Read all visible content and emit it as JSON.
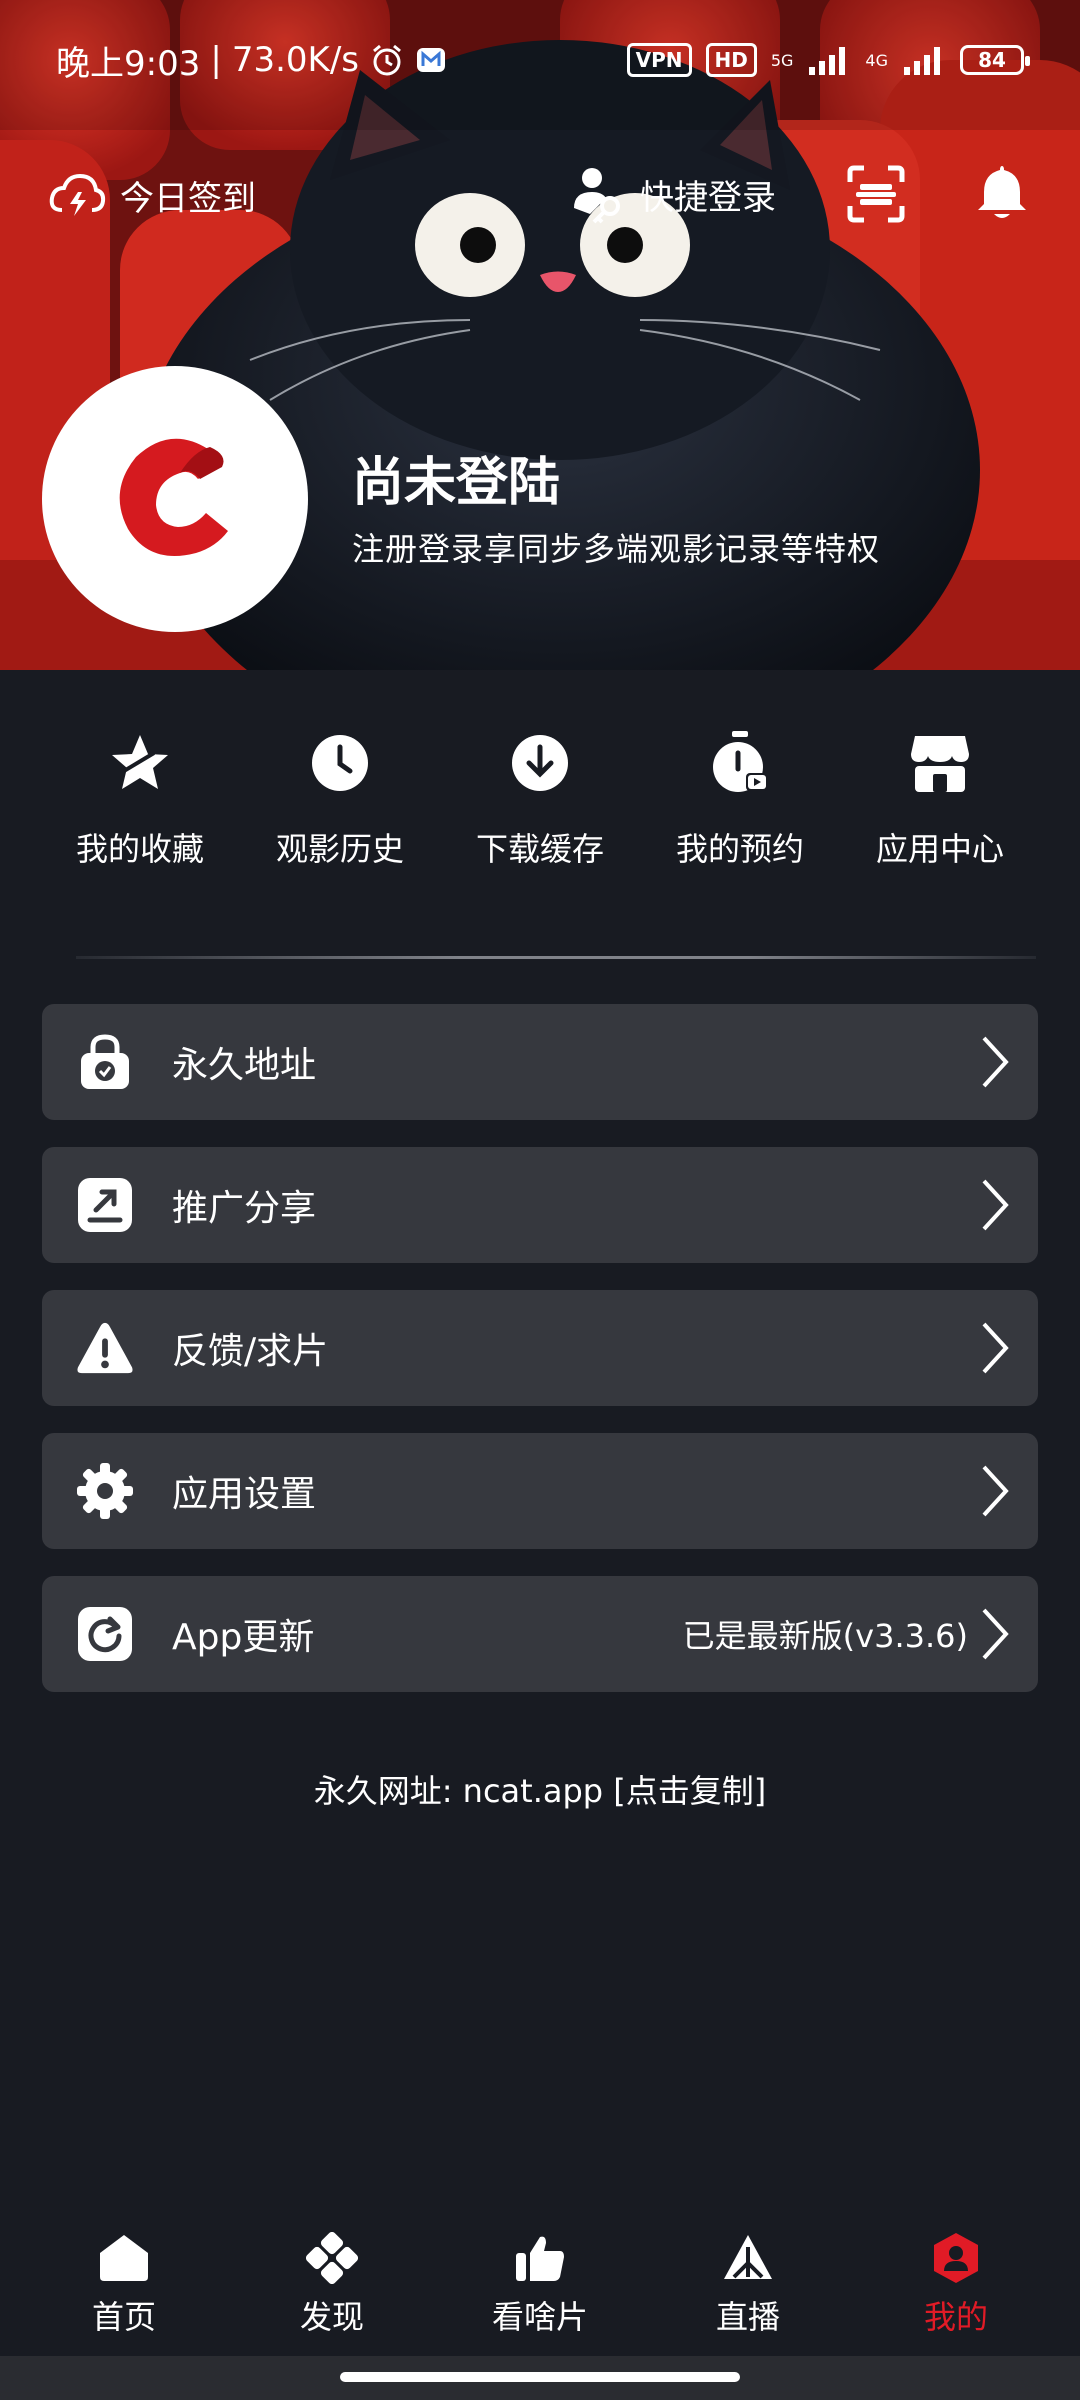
{
  "status_bar": {
    "time": "晚上9:03",
    "speed": "73.0K/s",
    "vpn": "VPN",
    "hd": "HD",
    "net_5g": "5G",
    "net_4g": "4G",
    "battery": "84"
  },
  "header": {
    "checkin_label": "今日签到",
    "quick_login_label": "快捷登录"
  },
  "profile": {
    "name": "尚未登陆",
    "subtitle": "注册登录享同步多端观影记录等特权"
  },
  "quick_actions": [
    {
      "label": "我的收藏",
      "icon": "star-icon"
    },
    {
      "label": "观影历史",
      "icon": "clock-icon"
    },
    {
      "label": "下载缓存",
      "icon": "download-icon"
    },
    {
      "label": "我的预约",
      "icon": "timer-icon"
    },
    {
      "label": "应用中心",
      "icon": "store-icon"
    }
  ],
  "menu": [
    {
      "label": "永久地址",
      "icon": "lock-icon",
      "value": ""
    },
    {
      "label": "推广分享",
      "icon": "share-icon",
      "value": ""
    },
    {
      "label": "反馈/求片",
      "icon": "warning-icon",
      "value": ""
    },
    {
      "label": "应用设置",
      "icon": "gear-icon",
      "value": ""
    },
    {
      "label": "App更新",
      "icon": "refresh-icon",
      "value": "已是最新版(v3.3.6)"
    }
  ],
  "permanent_url": "永久网址: ncat.app [点击复制]",
  "bottom_nav": [
    {
      "label": "首页",
      "icon": "home-icon",
      "active": false
    },
    {
      "label": "发现",
      "icon": "discover-icon",
      "active": false
    },
    {
      "label": "看啥片",
      "icon": "thumbs-up-icon",
      "active": false
    },
    {
      "label": "直播",
      "icon": "live-icon",
      "active": false
    },
    {
      "label": "我的",
      "icon": "profile-icon",
      "active": true
    }
  ],
  "colors": {
    "background": "#181b22",
    "card": "#36383e",
    "accent": "#e11b26"
  }
}
